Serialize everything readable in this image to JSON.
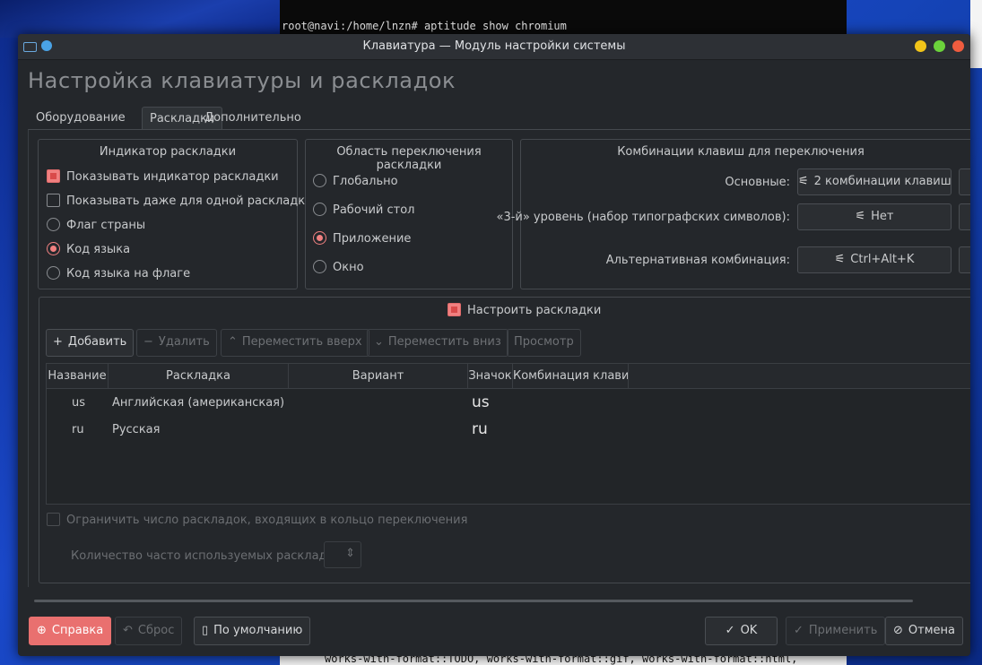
{
  "terminal": {
    "top_line": "root@navi:/home/lnzn# aptitude show chromium",
    "bottom_line": "works-with-format::TODO, works-with-format::gif, works-with-format::html,"
  },
  "window": {
    "title": "Клавиатура — Модуль настройки системы",
    "heading": "Настройка клавиатуры и раскладок"
  },
  "tabs": [
    {
      "label": "Оборудование"
    },
    {
      "label": "Раскладки"
    },
    {
      "label": "Дополнительно"
    }
  ],
  "indicator": {
    "title": "Индикатор раскладки",
    "show_indicator": "Показывать индикатор раскладки",
    "show_single": "Показывать даже для одной раскладки",
    "flag": "Флаг страны",
    "code": "Код языка",
    "code_on_flag": "Код языка на флаге"
  },
  "scope": {
    "title": "Область переключения раскладки",
    "global": "Глобально",
    "desktop": "Рабочий стол",
    "application": "Приложение",
    "window": "Окно"
  },
  "shortcuts": {
    "title": "Комбинации клавиш для переключения",
    "main_label": "Основные:",
    "main_value": "2 комбинации клавиш",
    "third_label": "«3-й» уровень (набор типографских символов):",
    "third_value": "Нет",
    "alt_label": "Альтернативная комбинация:",
    "alt_value": "Ctrl+Alt+K",
    "icon": "sliders-icon"
  },
  "layouts": {
    "configure_label": "Настроить раскладки",
    "toolbar": {
      "add": "Добавить",
      "remove": "Удалить",
      "move_up": "Переместить вверх",
      "move_down": "Переместить вниз",
      "preview": "Просмотр"
    },
    "columns": [
      "Название",
      "Раскладка",
      "Вариант",
      "Значок",
      "Комбинация клавиш"
    ],
    "rows": [
      {
        "name": "us",
        "layout": "Английская (американская)",
        "variant": "",
        "icon": "us",
        "shortcut": ""
      },
      {
        "name": "ru",
        "layout": "Русская",
        "variant": "",
        "icon": "ru",
        "shortcut": ""
      }
    ],
    "limit_label": "Ограничить число раскладок, входящих в кольцо переключения",
    "count_label": "Количество часто используемых раскладок:"
  },
  "buttons": {
    "help": "Справка",
    "reset": "Сброс",
    "defaults": "По умолчанию",
    "ok": "OK",
    "apply": "Применить",
    "cancel": "Отмена"
  },
  "colors": {
    "accent": "#f08080",
    "window_bg": "#24272b",
    "help_button": "#e9706f"
  }
}
